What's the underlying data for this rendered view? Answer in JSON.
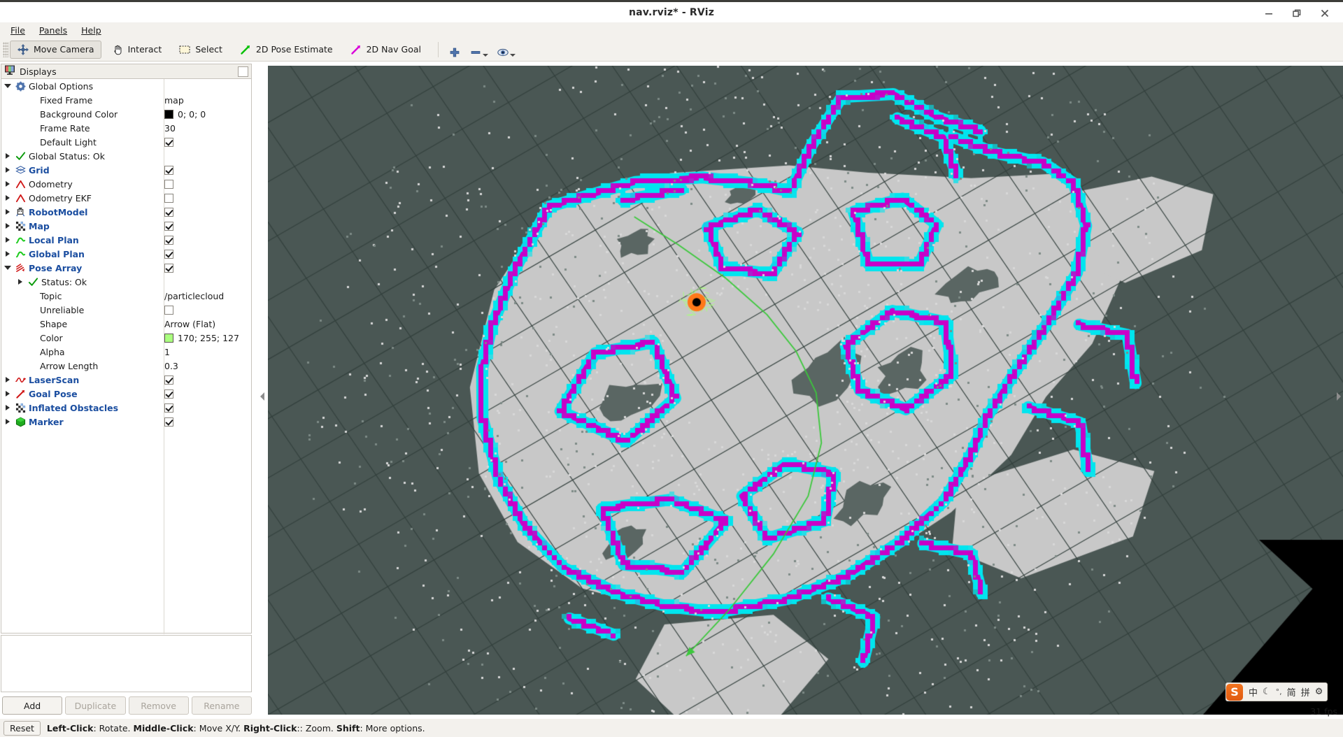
{
  "window": {
    "title": "nav.rviz* - RViz",
    "controls": [
      {
        "name": "minimize",
        "glyph": "minimize-icon"
      },
      {
        "name": "maximize",
        "glyph": "maximize-icon"
      },
      {
        "name": "close",
        "glyph": "close-icon"
      }
    ]
  },
  "menubar": {
    "items": [
      {
        "label": "File",
        "mnemonic": "F"
      },
      {
        "label": "Panels",
        "mnemonic": "P"
      },
      {
        "label": "Help",
        "mnemonic": "H"
      }
    ]
  },
  "toolbar": {
    "buttons": [
      {
        "label": "Move Camera",
        "icon": "move-camera-icon",
        "active": true
      },
      {
        "label": "Interact",
        "icon": "hand-cursor-icon",
        "active": false
      },
      {
        "label": "Select",
        "icon": "select-rect-icon",
        "active": false
      },
      {
        "label": "2D Pose Estimate",
        "icon": "green-arrow-icon",
        "active": false
      },
      {
        "label": "2D Nav Goal",
        "icon": "magenta-arrow-icon",
        "active": false
      }
    ],
    "tools": [
      {
        "name": "focus-add-icon",
        "glyph": "plus"
      },
      {
        "name": "focus-remove-icon",
        "glyph": "minus"
      },
      {
        "name": "focus-camera-icon",
        "glyph": "eye"
      }
    ]
  },
  "displays": {
    "panel_title": "Displays",
    "tree": [
      {
        "indent": 0,
        "twist": "open",
        "icon": "gear-icon",
        "label": "Global Options",
        "bold": false,
        "value_type": "none"
      },
      {
        "indent": 1,
        "twist": "none",
        "icon": "none",
        "label": "Fixed Frame",
        "bold": false,
        "value_type": "text",
        "value": "map"
      },
      {
        "indent": 1,
        "twist": "none",
        "icon": "none",
        "label": "Background Color",
        "bold": false,
        "value_type": "color",
        "value": "0; 0; 0",
        "color": "#000000"
      },
      {
        "indent": 1,
        "twist": "none",
        "icon": "none",
        "label": "Frame Rate",
        "bold": false,
        "value_type": "text",
        "value": "30"
      },
      {
        "indent": 1,
        "twist": "none",
        "icon": "none",
        "label": "Default Light",
        "bold": false,
        "value_type": "check",
        "checked": true
      },
      {
        "indent": 0,
        "twist": "closed",
        "icon": "check-icon",
        "label": "Global Status: Ok",
        "bold": false,
        "value_type": "none"
      },
      {
        "indent": 0,
        "twist": "closed",
        "icon": "grid-icon",
        "label": "Grid",
        "bold": true,
        "value_type": "check",
        "checked": true
      },
      {
        "indent": 0,
        "twist": "closed",
        "icon": "odometry-icon",
        "label": "Odometry",
        "bold": false,
        "value_type": "check",
        "checked": false
      },
      {
        "indent": 0,
        "twist": "closed",
        "icon": "odometry-icon",
        "label": "Odometry EKF",
        "bold": false,
        "value_type": "check",
        "checked": false
      },
      {
        "indent": 0,
        "twist": "closed",
        "icon": "robot-icon",
        "label": "RobotModel",
        "bold": true,
        "value_type": "check",
        "checked": true
      },
      {
        "indent": 0,
        "twist": "closed",
        "icon": "map-icon",
        "label": "Map",
        "bold": true,
        "value_type": "check",
        "checked": true
      },
      {
        "indent": 0,
        "twist": "closed",
        "icon": "path-icon",
        "label": "Local Plan",
        "bold": true,
        "value_type": "check",
        "checked": true
      },
      {
        "indent": 0,
        "twist": "closed",
        "icon": "path-icon",
        "label": "Global Plan",
        "bold": true,
        "value_type": "check",
        "checked": true
      },
      {
        "indent": 0,
        "twist": "open",
        "icon": "posearray-icon",
        "label": "Pose Array",
        "bold": true,
        "value_type": "check",
        "checked": true
      },
      {
        "indent": 1,
        "twist": "closed",
        "icon": "check-icon",
        "label": "Status: Ok",
        "bold": false,
        "value_type": "none"
      },
      {
        "indent": 1,
        "twist": "none",
        "icon": "none",
        "label": "Topic",
        "bold": false,
        "value_type": "text",
        "value": "/particlecloud"
      },
      {
        "indent": 1,
        "twist": "none",
        "icon": "none",
        "label": "Unreliable",
        "bold": false,
        "value_type": "check",
        "checked": false
      },
      {
        "indent": 1,
        "twist": "none",
        "icon": "none",
        "label": "Shape",
        "bold": false,
        "value_type": "text",
        "value": "Arrow (Flat)"
      },
      {
        "indent": 1,
        "twist": "none",
        "icon": "none",
        "label": "Color",
        "bold": false,
        "value_type": "color",
        "value": "170; 255; 127",
        "color": "#aaff7f"
      },
      {
        "indent": 1,
        "twist": "none",
        "icon": "none",
        "label": "Alpha",
        "bold": false,
        "value_type": "text",
        "value": "1"
      },
      {
        "indent": 1,
        "twist": "none",
        "icon": "none",
        "label": "Arrow Length",
        "bold": false,
        "value_type": "text",
        "value": "0.3"
      },
      {
        "indent": 0,
        "twist": "closed",
        "icon": "laserscan-icon",
        "label": "LaserScan",
        "bold": true,
        "value_type": "check",
        "checked": true
      },
      {
        "indent": 0,
        "twist": "closed",
        "icon": "pose-icon",
        "label": "Goal Pose",
        "bold": true,
        "value_type": "check",
        "checked": true
      },
      {
        "indent": 0,
        "twist": "closed",
        "icon": "map-icon",
        "label": "Inflated Obstacles",
        "bold": true,
        "value_type": "check",
        "checked": true
      },
      {
        "indent": 0,
        "twist": "closed",
        "icon": "marker-icon",
        "label": "Marker",
        "bold": true,
        "value_type": "check",
        "checked": true
      }
    ],
    "buttons": [
      {
        "label": "Add",
        "enabled": true
      },
      {
        "label": "Duplicate",
        "enabled": false
      },
      {
        "label": "Remove",
        "enabled": false
      },
      {
        "label": "Rename",
        "enabled": false
      }
    ]
  },
  "statusbar": {
    "reset_label": "Reset",
    "hint_parts": [
      {
        "text": "Left-Click",
        "bold": true
      },
      {
        "text": ": Rotate. ",
        "bold": false
      },
      {
        "text": "Middle-Click",
        "bold": true
      },
      {
        "text": ": Move X/Y. ",
        "bold": false
      },
      {
        "text": "Right-Click",
        "bold": true
      },
      {
        "text": ":: Zoom. ",
        "bold": false
      },
      {
        "text": "Shift",
        "bold": true
      },
      {
        "text": ": More options.",
        "bold": false
      }
    ]
  },
  "view3d": {
    "fps": "31 fps",
    "colors": {
      "background": "#4a5754",
      "grid_line": "#33403d",
      "map_free": "#c8c8c8",
      "map_unknown": "#4a5754",
      "obstacle_cyan": "#00e5ef",
      "obstacle_magenta": "#c800c8",
      "path_green": "#3cc83c",
      "robot_body": "#ff7819",
      "robot_center": "#000000",
      "particles": "#aaff7f"
    }
  },
  "ime": {
    "logo": "S",
    "items": [
      "中",
      "☾",
      "°,",
      "简",
      "拼",
      "⚙"
    ]
  }
}
